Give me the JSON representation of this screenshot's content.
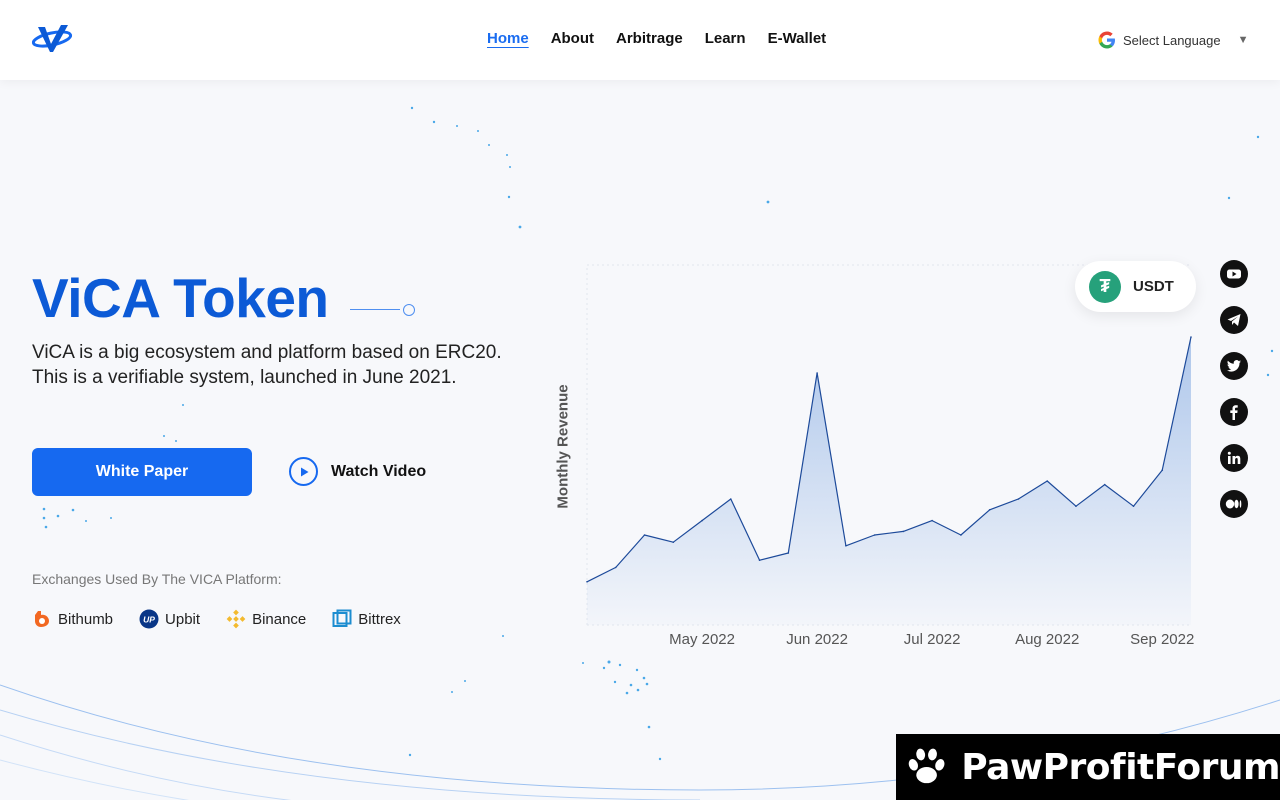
{
  "header": {
    "nav": [
      {
        "label": "Home",
        "active": true
      },
      {
        "label": "About"
      },
      {
        "label": "Arbitrage"
      },
      {
        "label": "Learn"
      },
      {
        "label": "E-Wallet"
      }
    ],
    "language_label": "Select Language",
    "language_caret": "▼"
  },
  "hero": {
    "title": "ViCA Token",
    "description_line1": "ViCA is a big ecosystem and platform based on ERC20.",
    "description_line2": "This is a verifiable system, launched in June 2021.",
    "primary_button": "White Paper",
    "video_button": "Watch Video"
  },
  "exchanges": {
    "label": "Exchanges Used By The VICA Platform:",
    "items": [
      {
        "name": "Bithumb",
        "icon": "bithumb-icon",
        "color": "#f26822"
      },
      {
        "name": "Upbit",
        "icon": "upbit-icon",
        "color": "#093687"
      },
      {
        "name": "Binance",
        "icon": "binance-icon",
        "color": "#f3ba2f"
      },
      {
        "name": "Bittrex",
        "icon": "bittrex-icon",
        "color": "#1c8dd0"
      }
    ]
  },
  "chart_data": {
    "type": "area",
    "title": "",
    "xlabel": "",
    "ylabel": "Monthly Revenue",
    "x_tick_labels": [
      "May 2022",
      "Jun 2022",
      "Jul 2022",
      "Aug 2022",
      "Sep 2022"
    ],
    "x_tick_positions": [
      4,
      8,
      12,
      16,
      20
    ],
    "x": [
      0,
      1,
      2,
      3,
      4,
      5,
      6,
      7,
      8,
      9,
      10,
      11,
      12,
      13,
      14,
      15,
      16,
      17,
      18,
      19,
      20,
      21
    ],
    "values": [
      12,
      16,
      25,
      23,
      29,
      35,
      18,
      20,
      70,
      22,
      25,
      26,
      29,
      25,
      32,
      35,
      40,
      33,
      39,
      33,
      43,
      80
    ],
    "ylim": [
      0,
      100
    ],
    "grid": false,
    "series_color": "#1d4a9a",
    "fill_color": "#aac4ea",
    "currency_badge": "USDT"
  },
  "socials": [
    {
      "name": "youtube"
    },
    {
      "name": "telegram"
    },
    {
      "name": "twitter"
    },
    {
      "name": "facebook"
    },
    {
      "name": "linkedin"
    },
    {
      "name": "medium"
    }
  ],
  "watermark": {
    "text": "PawProfitForum"
  },
  "colors": {
    "accent": "#1669f0",
    "title": "#0c5ad6",
    "usdt": "#26a17b"
  }
}
